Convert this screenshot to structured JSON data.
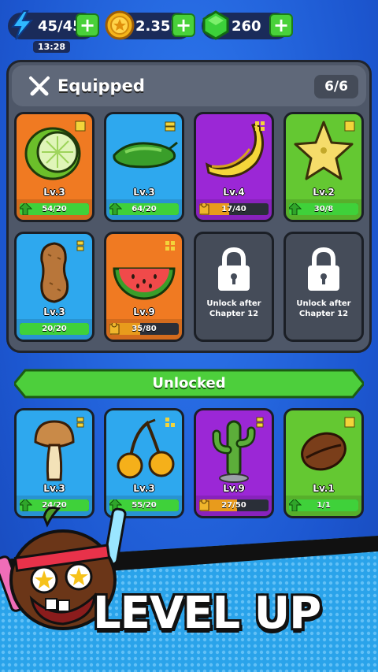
{
  "resources": {
    "energy": {
      "value": "45/45",
      "timer": "13:28",
      "icon": "lightning-icon"
    },
    "coins": {
      "value": "2.35k",
      "icon": "coin-icon"
    },
    "gems": {
      "value": "260",
      "icon": "green-gem-icon"
    }
  },
  "equipped": {
    "title": "Equipped",
    "count": "6/6",
    "cards": [
      {
        "name": "lime",
        "level": "Lv.3",
        "progress": "54/20",
        "rarity": "orange",
        "fill": 1.0
      },
      {
        "name": "cucumber",
        "level": "Lv.3",
        "progress": "64/20",
        "rarity": "blue",
        "fill": 1.0
      },
      {
        "name": "banana",
        "level": "Lv.4",
        "progress": "17/40",
        "rarity": "purple",
        "fill": 0.43
      },
      {
        "name": "starfruit",
        "level": "Lv.2",
        "progress": "30/8",
        "rarity": "green",
        "fill": 1.0
      },
      {
        "name": "peanut",
        "level": "Lv.3",
        "progress": "20/20",
        "rarity": "blue",
        "fill": 1.0
      },
      {
        "name": "watermelon",
        "level": "Lv.9",
        "progress": "35/80",
        "rarity": "orange",
        "fill": 0.44
      },
      {
        "locked": true,
        "text_line1": "Unlock after",
        "text_line2": "Chapter 12"
      },
      {
        "locked": true,
        "text_line1": "Unlock after",
        "text_line2": "Chapter 12"
      }
    ]
  },
  "unlocked": {
    "title": "Unlocked",
    "cards": [
      {
        "name": "mushroom",
        "level": "Lv.3",
        "progress": "24/20",
        "rarity": "blue",
        "fill": 1.0
      },
      {
        "name": "cherries",
        "level": "Lv.3",
        "progress": "55/20",
        "rarity": "blue",
        "fill": 1.0
      },
      {
        "name": "cactus",
        "level": "Lv.9",
        "progress": "27/50",
        "rarity": "purple",
        "fill": 0.54
      },
      {
        "name": "coffee-bean",
        "level": "Lv.1",
        "progress": "1/1",
        "rarity": "green",
        "fill": 1.0
      }
    ]
  },
  "banner": {
    "text": "LEVEL UP"
  },
  "colors": {
    "orange": "#f07a22",
    "blue": "#2ea8ee",
    "purple": "#9b27d6",
    "green": "#64c832",
    "bar_green": "#3fd13a",
    "bar_orange": "#e89b1c"
  }
}
